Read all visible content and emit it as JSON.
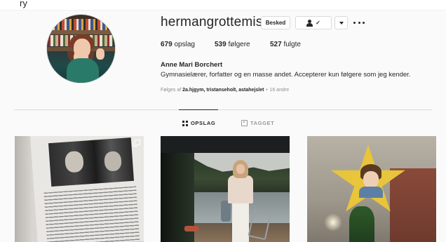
{
  "header_fragment": "ry",
  "profile": {
    "username": "hermangrottemis",
    "buttons": {
      "message": "Besked"
    },
    "stats": [
      {
        "count": "679",
        "label": "opslag"
      },
      {
        "count": "539",
        "label": "følgere"
      },
      {
        "count": "527",
        "label": "fulgte"
      }
    ],
    "full_name": "Anne Mari Borchert",
    "bio": "Gymnasielærer, forfatter og en masse andet. Accepterer kun følgere som jeg kender.",
    "followed_by": {
      "prefix": "Følges af",
      "names": "2a.hjgym, tristanseholt, astahejslet",
      "suffix": "+ 16 andre"
    }
  },
  "tabs": [
    {
      "label": "OPSLAG",
      "icon": "grid-icon",
      "active": true
    },
    {
      "label": "TAGGET",
      "icon": "tag-icon",
      "active": false
    }
  ],
  "posts": [
    {
      "subject": "book page with black-and-white photo",
      "icon": "multiple-images-icon"
    },
    {
      "subject": "woman standing by a lake"
    },
    {
      "subject": "child face on yellow star"
    }
  ]
}
